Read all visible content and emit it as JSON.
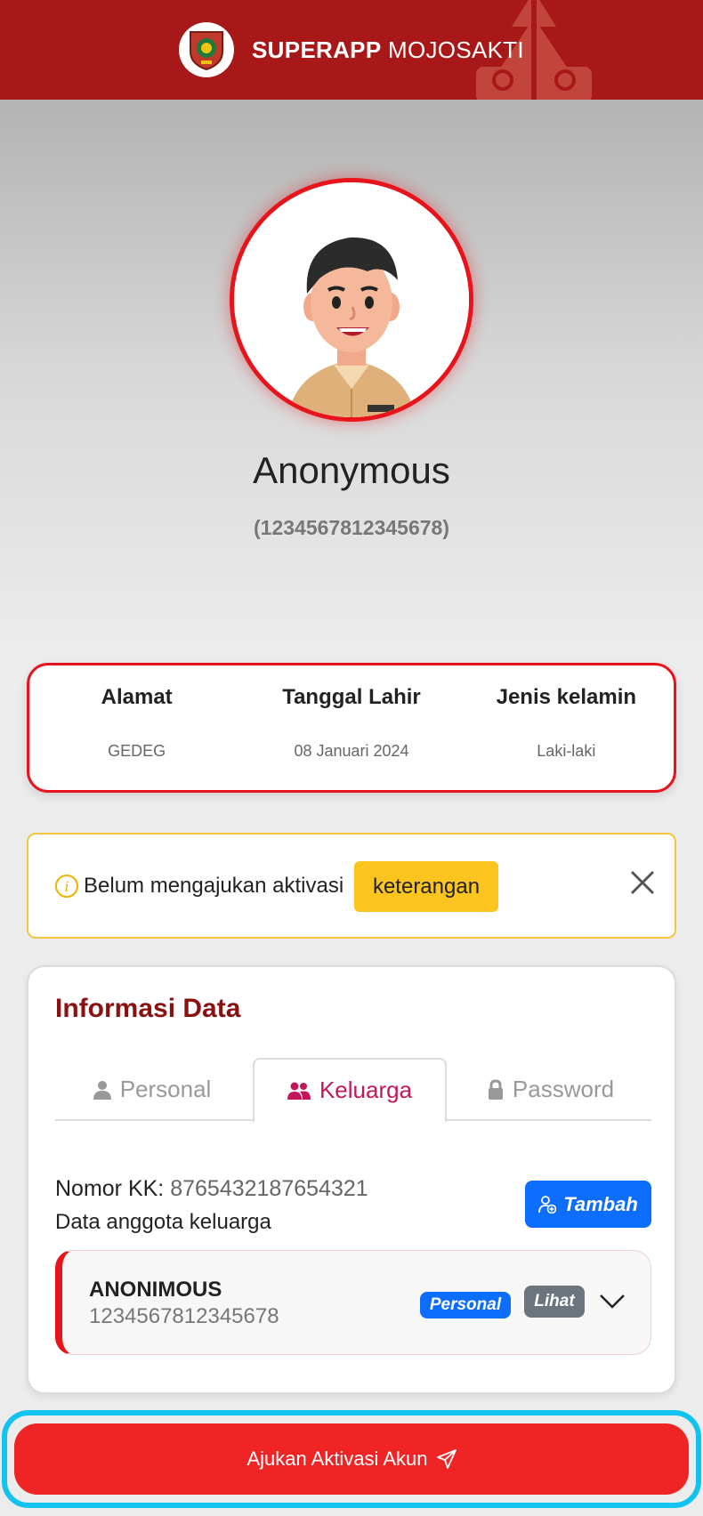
{
  "header": {
    "title_bold": "SUPERAPP",
    "title_rest": " MOJOSAKTI",
    "logo_icon": "regency-seal-icon",
    "ornament_icon": "candi-bentar-ornament-icon"
  },
  "profile": {
    "name": "Anonymous",
    "nik": "(1234567812345678)"
  },
  "info": [
    {
      "label": "Alamat",
      "value": "GEDEG"
    },
    {
      "label": "Tanggal Lahir",
      "value": "08 Januari 2024"
    },
    {
      "label": "Jenis kelamin",
      "value": "Laki-laki"
    }
  ],
  "alert": {
    "text": "Belum mengajukan aktivasi",
    "button": "keterangan"
  },
  "panel": {
    "title": "Informasi Data",
    "tabs": [
      {
        "label": "Personal",
        "icon": "user-icon"
      },
      {
        "label": "Keluarga",
        "icon": "users-icon"
      },
      {
        "label": "Password",
        "icon": "lock-icon"
      }
    ],
    "active_tab": "Keluarga",
    "kk_label": "Nomor KK: ",
    "kk_value": "8765432187654321",
    "family_label": "Data anggota keluarga",
    "add_button": "Tambah",
    "members": [
      {
        "name": "ANONIMOUS",
        "nik": "1234567812345678",
        "badge": "Personal",
        "view": "Lihat"
      }
    ]
  },
  "action": {
    "label": "Ajukan Aktivasi Akun"
  },
  "colors": {
    "header": "#a81818",
    "accent_red": "#e8141c",
    "title_red": "#8b1010",
    "active_tab": "#c2185b",
    "primary_blue": "#0d6efd",
    "warning": "#fcc41f",
    "action_button": "#f02424",
    "focus_ring": "#12c3f0"
  }
}
